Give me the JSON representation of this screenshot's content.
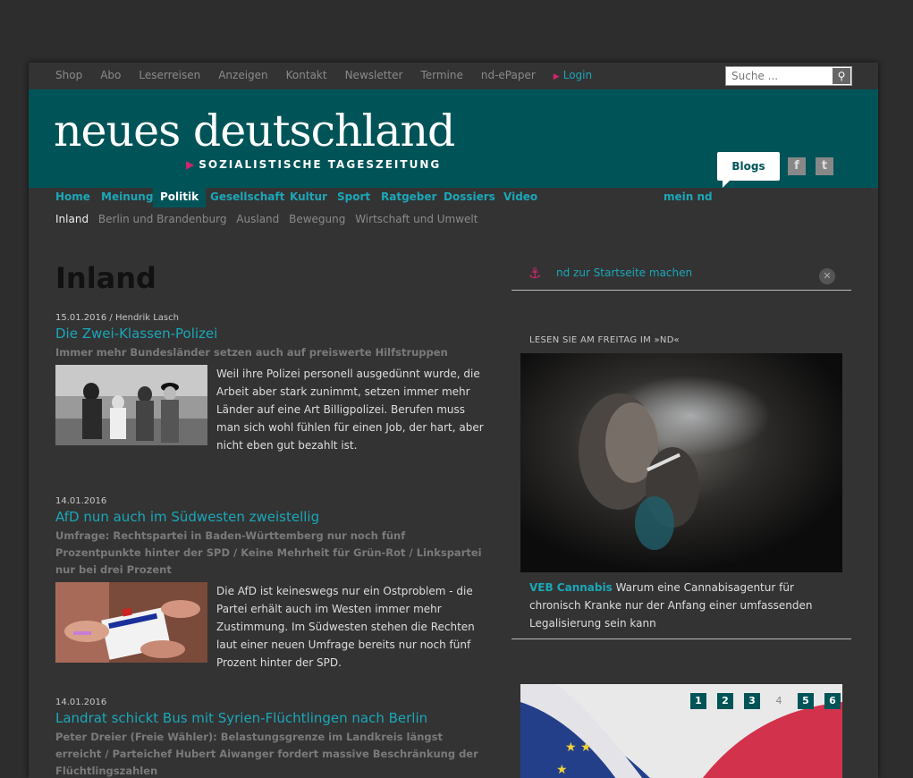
{
  "top": {
    "links": [
      "Shop",
      "Abo",
      "Leserreisen",
      "Anzeigen",
      "Kontakt",
      "Newsletter",
      "Termine",
      "nd-ePaper"
    ],
    "login": "Login",
    "search_placeholder": "Suche ..."
  },
  "brand": {
    "logo": "neues deutschland",
    "tagline": "SOZIALISTISCHE TAGESZEITUNG",
    "blogs": "Blogs",
    "accent": "#005458",
    "link_color": "#1aa7b8",
    "marker_color": "#d4246e"
  },
  "nav": {
    "items": [
      "Home",
      "Meinung",
      "Politik",
      "Gesellschaft",
      "Kultur",
      "Sport",
      "Ratgeber",
      "Dossiers",
      "Video"
    ],
    "active": "Politik",
    "mein": "mein nd"
  },
  "subnav": {
    "items": [
      "Inland",
      "Berlin und Brandenburg",
      "Ausland",
      "Bewegung",
      "Wirtschaft und Umwelt"
    ],
    "current": "Inland"
  },
  "page_title": "Inland",
  "articles": [
    {
      "meta": "15.01.2016 / Hendrik Lasch",
      "title": "Die Zwei-Klassen-Polizei",
      "subtitle": "Immer mehr Bundesländer setzen auch auf preiswerte Hilfstruppen",
      "text": "Weil ihre Polizei personell ausgedünnt wurde, die Arbeit aber stark zunimmt, setzen immer mehr Länder auf eine Art Billigpolizei. Berufen muss man sich wohl fühlen für einen Job, der hart, aber nicht eben gut bezahlt ist."
    },
    {
      "meta": "14.01.2016",
      "title": "AfD nun auch im Südwesten zweistellig",
      "subtitle": "Umfrage: Rechtspartei in Baden-Württemberg nur noch fünf Prozentpunkte hinter der SPD / Keine Mehrheit für Grün-Rot / Linkspartei nur bei drei Prozent",
      "text": "Die AfD ist keineswegs nur ein Ostproblem - die Partei erhält auch im Westen immer mehr Zustimmung. Im Südwesten stehen die Rechten laut einer neuen Umfrage bereits nur noch fünf Prozent hinter der SPD."
    },
    {
      "meta": "14.01.2016",
      "title": "Landrat schickt Bus mit Syrien-Flüchtlingen nach Berlin",
      "subtitle": "Peter Dreier (Freie Wähler): Belastungsgrenze im Landkreis längst erreicht / Parteichef Hubert Aiwanger fordert massive Beschränkung der Flüchtlingszahlen",
      "text": ""
    }
  ],
  "sidebar": {
    "startpage": "nd zur Startseite machen",
    "freitag_label": "LESEN SIE AM FREITAG IM »ND«",
    "caption_key": "VEB Cannabis",
    "caption_text": "Warum eine Cannabisagentur für chronisch Kranke nur der Anfang einer umfassenden Legalisierung sein kann",
    "pager": [
      "1",
      "2",
      "3",
      "4",
      "5",
      "6"
    ],
    "pager_current": "4"
  }
}
